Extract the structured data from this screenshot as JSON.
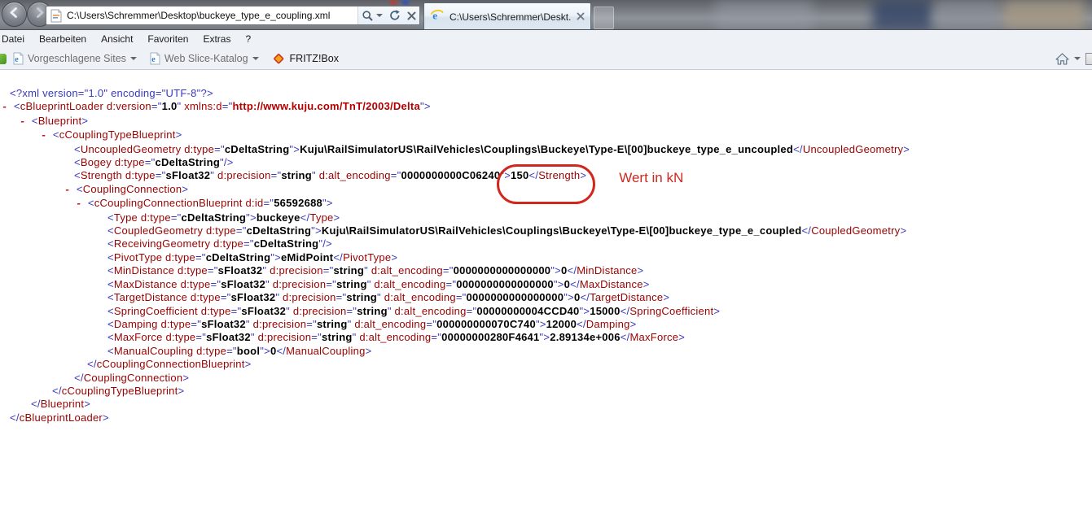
{
  "browser": {
    "address": {
      "url": "C:\\Users\\Schremmer\\Desktop\\buckeye_type_e_coupling.xml"
    },
    "tab_title": "C:\\Users\\Schremmer\\Deskt...",
    "menu": [
      "Datei",
      "Bearbeiten",
      "Ansicht",
      "Favoriten",
      "Extras",
      "?"
    ],
    "favorites": [
      {
        "label": "Vorgeschlagene Sites",
        "icon": "ie-page",
        "caret": true
      },
      {
        "label": "Web Slice-Katalog",
        "icon": "ie-page",
        "caret": true
      },
      {
        "label": "FRITZ!Box",
        "icon": "fritz",
        "caret": false
      }
    ],
    "icons": {
      "back": "arrow-left-circle",
      "forward": "arrow-right-circle",
      "search": "magnifier",
      "refresh": "circular-arrow",
      "stop": "x",
      "tab_brand": "ie-logo",
      "tab_close": "x",
      "home": "house",
      "favorites_default": "ie-page-with-e",
      "fritz": "orange-diamond"
    }
  },
  "annotation": {
    "label": "Wert in kN",
    "color": "#d0281e"
  },
  "xml": {
    "lines": [
      {
        "p": 12,
        "t": [
          [
            "pi",
            "<?xml version=\"1.0\" encoding=\"UTF-8\"?>"
          ]
        ]
      },
      {
        "p": 2,
        "t": [
          [
            "b",
            "- "
          ],
          [
            "m",
            "<"
          ],
          [
            "t",
            "cBlueprintLoader"
          ],
          [
            "t",
            " d:version"
          ],
          [
            "m",
            "=\""
          ],
          [
            "v",
            "1.0"
          ],
          [
            "m",
            "\""
          ],
          [
            "ns",
            " xmlns:d"
          ],
          [
            "m",
            "=\""
          ],
          [
            "nsv",
            "http://www.kuju.com/TnT/2003/Delta"
          ],
          [
            "m",
            "\">"
          ]
        ]
      },
      {
        "p": 24,
        "t": [
          [
            "b",
            "- "
          ],
          [
            "m",
            "<"
          ],
          [
            "t",
            "Blueprint"
          ],
          [
            "m",
            ">"
          ]
        ]
      },
      {
        "p": 50,
        "t": [
          [
            "b",
            "- "
          ],
          [
            "m",
            "<"
          ],
          [
            "t",
            "cCouplingTypeBlueprint"
          ],
          [
            "m",
            ">"
          ]
        ]
      },
      {
        "p": 91,
        "t": [
          [
            "m",
            "<"
          ],
          [
            "t",
            "UncoupledGeometry"
          ],
          [
            "t",
            " d:type"
          ],
          [
            "m",
            "=\""
          ],
          [
            "v",
            "cDeltaString"
          ],
          [
            "m",
            "\">"
          ],
          [
            "x",
            "Kuju\\RailSimulatorUS\\RailVehicles\\Couplings\\Buckeye\\Type-E\\[00]buckeye_type_e_uncoupled"
          ],
          [
            "m",
            "</"
          ],
          [
            "t",
            "UncoupledGeometry"
          ],
          [
            "m",
            ">"
          ]
        ]
      },
      {
        "p": 91,
        "t": [
          [
            "m",
            "<"
          ],
          [
            "t",
            "Bogey"
          ],
          [
            "t",
            " d:type"
          ],
          [
            "m",
            "=\""
          ],
          [
            "v",
            "cDeltaString"
          ],
          [
            "m",
            "\"/>"
          ]
        ]
      },
      {
        "p": 91,
        "t": [
          [
            "m",
            "<"
          ],
          [
            "t",
            "Strength"
          ],
          [
            "t",
            " d:type"
          ],
          [
            "m",
            "=\""
          ],
          [
            "v",
            "sFloat32"
          ],
          [
            "m",
            "\""
          ],
          [
            "t",
            " d:precision"
          ],
          [
            "m",
            "=\""
          ],
          [
            "v",
            "string"
          ],
          [
            "m",
            "\""
          ],
          [
            "t",
            " d:alt_encoding"
          ],
          [
            "m",
            "=\""
          ],
          [
            "v",
            "0000000000C06240"
          ],
          [
            "m",
            "\""
          ],
          [
            "m",
            ">",
            "circ-start"
          ],
          [
            "x",
            "150"
          ],
          [
            "m",
            "</"
          ],
          [
            "t",
            "Strength"
          ],
          [
            "m",
            ">",
            "circ-end"
          ]
        ]
      },
      {
        "p": 79,
        "t": [
          [
            "b",
            "- "
          ],
          [
            "m",
            "<"
          ],
          [
            "t",
            "CouplingConnection"
          ],
          [
            "m",
            ">"
          ]
        ]
      },
      {
        "p": 93,
        "t": [
          [
            "b",
            "- "
          ],
          [
            "m",
            "<"
          ],
          [
            "t",
            "cCouplingConnectionBlueprint"
          ],
          [
            "t",
            " d:id"
          ],
          [
            "m",
            "=\""
          ],
          [
            "v",
            "56592688"
          ],
          [
            "m",
            "\">"
          ]
        ]
      },
      {
        "p": 132,
        "t": [
          [
            "m",
            "<"
          ],
          [
            "t",
            "Type"
          ],
          [
            "t",
            " d:type"
          ],
          [
            "m",
            "=\""
          ],
          [
            "v",
            "cDeltaString"
          ],
          [
            "m",
            "\">"
          ],
          [
            "x",
            "buckeye"
          ],
          [
            "m",
            "</"
          ],
          [
            "t",
            "Type"
          ],
          [
            "m",
            ">"
          ]
        ]
      },
      {
        "p": 132,
        "t": [
          [
            "m",
            "<"
          ],
          [
            "t",
            "CoupledGeometry"
          ],
          [
            "t",
            " d:type"
          ],
          [
            "m",
            "=\""
          ],
          [
            "v",
            "cDeltaString"
          ],
          [
            "m",
            "\">"
          ],
          [
            "x",
            "Kuju\\RailSimulatorUS\\RailVehicles\\Couplings\\Buckeye\\Type-E\\[00]buckeye_type_e_coupled"
          ],
          [
            "m",
            "</"
          ],
          [
            "t",
            "CoupledGeometry"
          ],
          [
            "m",
            ">"
          ]
        ]
      },
      {
        "p": 132,
        "t": [
          [
            "m",
            "<"
          ],
          [
            "t",
            "ReceivingGeometry"
          ],
          [
            "t",
            " d:type"
          ],
          [
            "m",
            "=\""
          ],
          [
            "v",
            "cDeltaString"
          ],
          [
            "m",
            "\"/>"
          ]
        ]
      },
      {
        "p": 132,
        "t": [
          [
            "m",
            "<"
          ],
          [
            "t",
            "PivotType"
          ],
          [
            "t",
            " d:type"
          ],
          [
            "m",
            "=\""
          ],
          [
            "v",
            "cDeltaString"
          ],
          [
            "m",
            "\">"
          ],
          [
            "x",
            "eMidPoint"
          ],
          [
            "m",
            "</"
          ],
          [
            "t",
            "PivotType"
          ],
          [
            "m",
            ">"
          ]
        ]
      },
      {
        "p": 132,
        "t": [
          [
            "m",
            "<"
          ],
          [
            "t",
            "MinDistance"
          ],
          [
            "t",
            " d:type"
          ],
          [
            "m",
            "=\""
          ],
          [
            "v",
            "sFloat32"
          ],
          [
            "m",
            "\""
          ],
          [
            "t",
            " d:precision"
          ],
          [
            "m",
            "=\""
          ],
          [
            "v",
            "string"
          ],
          [
            "m",
            "\""
          ],
          [
            "t",
            " d:alt_encoding"
          ],
          [
            "m",
            "=\""
          ],
          [
            "v",
            "0000000000000000"
          ],
          [
            "m",
            "\">"
          ],
          [
            "x",
            "0"
          ],
          [
            "m",
            "</"
          ],
          [
            "t",
            "MinDistance"
          ],
          [
            "m",
            ">"
          ]
        ]
      },
      {
        "p": 132,
        "t": [
          [
            "m",
            "<"
          ],
          [
            "t",
            "MaxDistance"
          ],
          [
            "t",
            " d:type"
          ],
          [
            "m",
            "=\""
          ],
          [
            "v",
            "sFloat32"
          ],
          [
            "m",
            "\""
          ],
          [
            "t",
            " d:precision"
          ],
          [
            "m",
            "=\""
          ],
          [
            "v",
            "string"
          ],
          [
            "m",
            "\""
          ],
          [
            "t",
            " d:alt_encoding"
          ],
          [
            "m",
            "=\""
          ],
          [
            "v",
            "0000000000000000"
          ],
          [
            "m",
            "\">"
          ],
          [
            "x",
            "0"
          ],
          [
            "m",
            "</"
          ],
          [
            "t",
            "MaxDistance"
          ],
          [
            "m",
            ">"
          ]
        ]
      },
      {
        "p": 132,
        "t": [
          [
            "m",
            "<"
          ],
          [
            "t",
            "TargetDistance"
          ],
          [
            "t",
            " d:type"
          ],
          [
            "m",
            "=\""
          ],
          [
            "v",
            "sFloat32"
          ],
          [
            "m",
            "\""
          ],
          [
            "t",
            " d:precision"
          ],
          [
            "m",
            "=\""
          ],
          [
            "v",
            "string"
          ],
          [
            "m",
            "\""
          ],
          [
            "t",
            " d:alt_encoding"
          ],
          [
            "m",
            "=\""
          ],
          [
            "v",
            "0000000000000000"
          ],
          [
            "m",
            "\">"
          ],
          [
            "x",
            "0"
          ],
          [
            "m",
            "</"
          ],
          [
            "t",
            "TargetDistance"
          ],
          [
            "m",
            ">"
          ]
        ]
      },
      {
        "p": 132,
        "t": [
          [
            "m",
            "<"
          ],
          [
            "t",
            "SpringCoefficient"
          ],
          [
            "t",
            " d:type"
          ],
          [
            "m",
            "=\""
          ],
          [
            "v",
            "sFloat32"
          ],
          [
            "m",
            "\""
          ],
          [
            "t",
            " d:precision"
          ],
          [
            "m",
            "=\""
          ],
          [
            "v",
            "string"
          ],
          [
            "m",
            "\""
          ],
          [
            "t",
            " d:alt_encoding"
          ],
          [
            "m",
            "=\""
          ],
          [
            "v",
            "00000000004CCD40"
          ],
          [
            "m",
            "\">"
          ],
          [
            "x",
            "15000"
          ],
          [
            "m",
            "</"
          ],
          [
            "t",
            "SpringCoefficient"
          ],
          [
            "m",
            ">"
          ]
        ]
      },
      {
        "p": 132,
        "t": [
          [
            "m",
            "<"
          ],
          [
            "t",
            "Damping"
          ],
          [
            "t",
            " d:type"
          ],
          [
            "m",
            "=\""
          ],
          [
            "v",
            "sFloat32"
          ],
          [
            "m",
            "\""
          ],
          [
            "t",
            " d:precision"
          ],
          [
            "m",
            "=\""
          ],
          [
            "v",
            "string"
          ],
          [
            "m",
            "\""
          ],
          [
            "t",
            " d:alt_encoding"
          ],
          [
            "m",
            "=\""
          ],
          [
            "v",
            "000000000070C740"
          ],
          [
            "m",
            "\">"
          ],
          [
            "x",
            "12000"
          ],
          [
            "m",
            "</"
          ],
          [
            "t",
            "Damping"
          ],
          [
            "m",
            ">"
          ]
        ]
      },
      {
        "p": 132,
        "t": [
          [
            "m",
            "<"
          ],
          [
            "t",
            "MaxForce"
          ],
          [
            "t",
            " d:type"
          ],
          [
            "m",
            "=\""
          ],
          [
            "v",
            "sFloat32"
          ],
          [
            "m",
            "\""
          ],
          [
            "t",
            " d:precision"
          ],
          [
            "m",
            "=\""
          ],
          [
            "v",
            "string"
          ],
          [
            "m",
            "\""
          ],
          [
            "t",
            " d:alt_encoding"
          ],
          [
            "m",
            "=\""
          ],
          [
            "v",
            "00000000280F4641"
          ],
          [
            "m",
            "\">"
          ],
          [
            "x",
            "2.89134e+006"
          ],
          [
            "m",
            "</"
          ],
          [
            "t",
            "MaxForce"
          ],
          [
            "m",
            ">"
          ]
        ]
      },
      {
        "p": 132,
        "t": [
          [
            "m",
            "<"
          ],
          [
            "t",
            "ManualCoupling"
          ],
          [
            "t",
            " d:type"
          ],
          [
            "m",
            "=\""
          ],
          [
            "v",
            "bool"
          ],
          [
            "m",
            "\">"
          ],
          [
            "x",
            "0"
          ],
          [
            "m",
            "</"
          ],
          [
            "t",
            "ManualCoupling"
          ],
          [
            "m",
            ">"
          ]
        ]
      },
      {
        "p": 107,
        "t": [
          [
            "m",
            "</"
          ],
          [
            "t",
            "cCouplingConnectionBlueprint"
          ],
          [
            "m",
            ">"
          ]
        ]
      },
      {
        "p": 91,
        "t": [
          [
            "m",
            "</"
          ],
          [
            "t",
            "CouplingConnection"
          ],
          [
            "m",
            ">"
          ]
        ]
      },
      {
        "p": 64,
        "t": [
          [
            "m",
            "</"
          ],
          [
            "t",
            "cCouplingTypeBlueprint"
          ],
          [
            "m",
            ">"
          ]
        ]
      },
      {
        "p": 38,
        "t": [
          [
            "m",
            "</"
          ],
          [
            "t",
            "Blueprint"
          ],
          [
            "m",
            ">"
          ]
        ]
      },
      {
        "p": 12,
        "t": [
          [
            "m",
            "</"
          ],
          [
            "t",
            "cBlueprintLoader"
          ],
          [
            "m",
            ">"
          ]
        ]
      }
    ]
  }
}
